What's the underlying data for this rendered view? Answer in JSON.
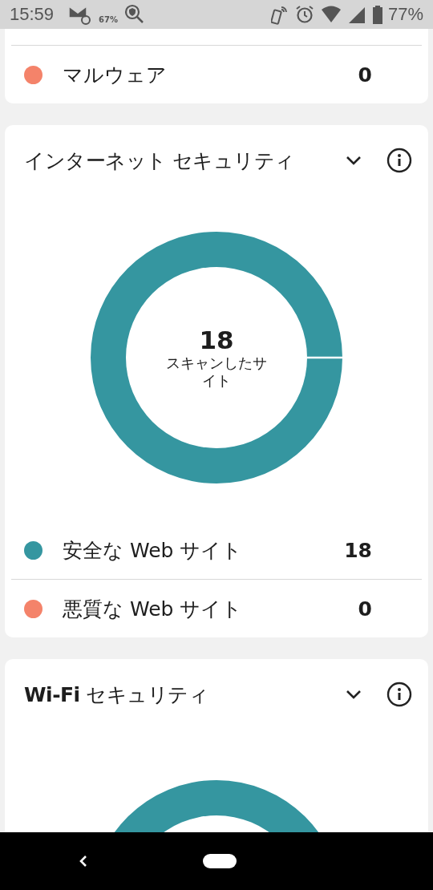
{
  "status_bar": {
    "time": "15:59",
    "data_saver_label": "67%",
    "battery": "77%"
  },
  "cards": [
    {
      "kind": "partial",
      "legend": [
        {
          "label": "マルウェア",
          "value": "0",
          "color": "#f4836a"
        }
      ]
    },
    {
      "kind": "donut",
      "title": "インターネット セキュリティ",
      "center_value": "18",
      "center_label": "スキャンしたサイト",
      "legend": [
        {
          "label": "安全な Web サイト",
          "value": "18",
          "color": "#3596a0"
        },
        {
          "label": "悪質な Web サイト",
          "value": "0",
          "color": "#f4836a"
        }
      ]
    },
    {
      "kind": "cut",
      "title": "**Wi-Fi** セキュリティ"
    }
  ]
}
